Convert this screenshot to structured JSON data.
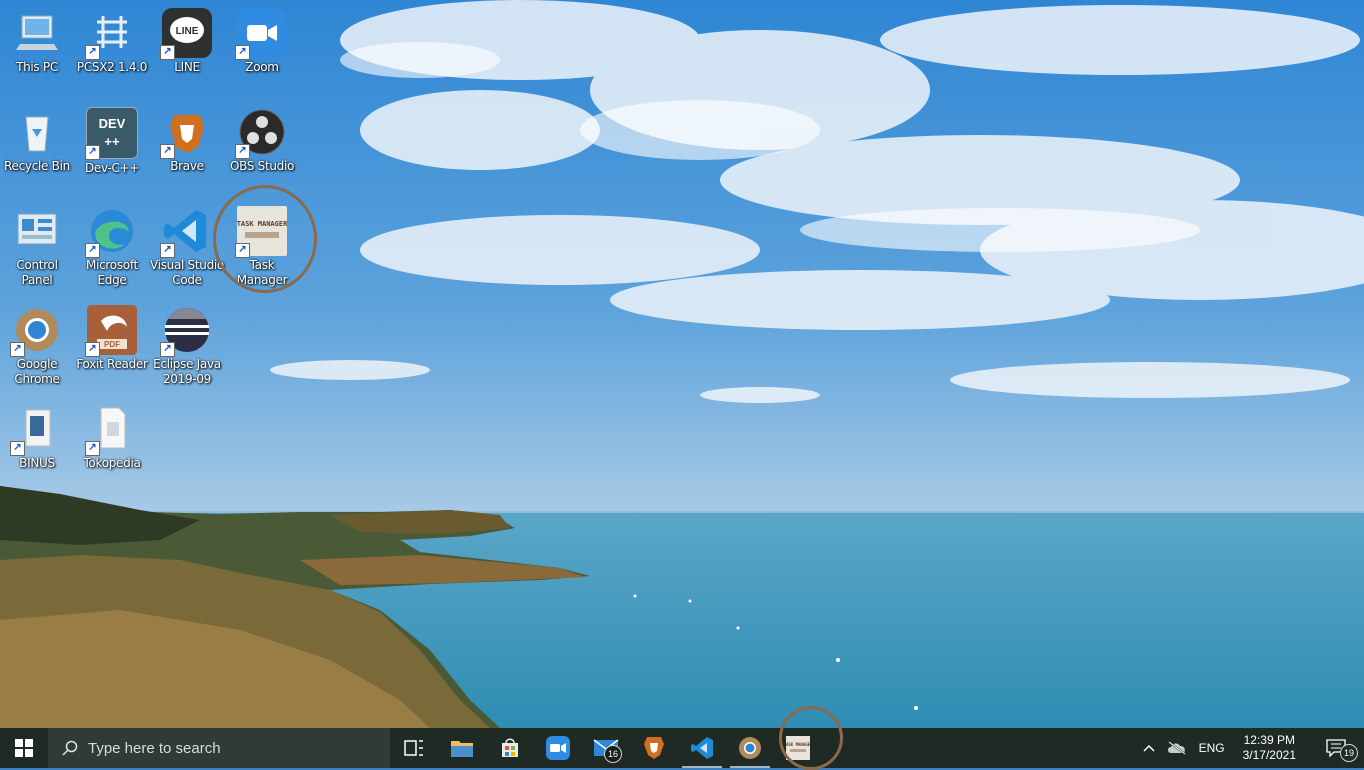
{
  "desktop": {
    "icons": [
      {
        "label": "This PC",
        "icon": "this-pc-icon"
      },
      {
        "label": "PCSX2 1.4.0",
        "icon": "pcsx2-icon"
      },
      {
        "label": "LINE",
        "icon": "line-icon"
      },
      {
        "label": "Zoom",
        "icon": "zoom-icon"
      },
      {
        "label": "Recycle Bin",
        "icon": "recycle-bin-icon"
      },
      {
        "label": "Dev-C++",
        "icon": "dev-cpp-icon"
      },
      {
        "label": "Brave",
        "icon": "brave-icon"
      },
      {
        "label": "OBS Studio",
        "icon": "obs-icon"
      },
      {
        "label": "Control Panel",
        "icon": "control-panel-icon"
      },
      {
        "label": "Microsoft Edge",
        "icon": "edge-icon"
      },
      {
        "label": "Visual Studio Code",
        "icon": "vscode-icon"
      },
      {
        "label": "Task Manager",
        "icon": "task-manager-icon"
      },
      {
        "label": "Google Chrome",
        "icon": "chrome-icon"
      },
      {
        "label": "Foxit Reader",
        "icon": "foxit-icon"
      },
      {
        "label": "Eclipse Java 2019-09",
        "icon": "eclipse-icon"
      },
      {
        "label": "BINUS",
        "icon": "folder-icon"
      },
      {
        "label": "Tokopedia",
        "icon": "document-icon"
      }
    ],
    "task_manager_icon_text": "TASK MANAGER",
    "highlight_color": "#8a6a4a"
  },
  "taskbar": {
    "search_placeholder": "Type here to search",
    "pinned": [
      {
        "name": "task-view",
        "icon": "task-view-icon"
      },
      {
        "name": "file-explorer",
        "icon": "folder-icon"
      },
      {
        "name": "microsoft-store",
        "icon": "store-icon"
      },
      {
        "name": "zoom",
        "icon": "zoom-icon"
      },
      {
        "name": "mail",
        "icon": "mail-icon",
        "badge": "16"
      },
      {
        "name": "brave",
        "icon": "brave-icon"
      },
      {
        "name": "vscode",
        "icon": "vscode-icon"
      },
      {
        "name": "chrome",
        "icon": "chrome-icon"
      },
      {
        "name": "task-manager",
        "icon": "task-manager-icon"
      }
    ],
    "tray": {
      "language": "ENG",
      "time": "12:39 PM",
      "date": "3/17/2021",
      "notifications": "19"
    },
    "background": "#1f2a24"
  }
}
